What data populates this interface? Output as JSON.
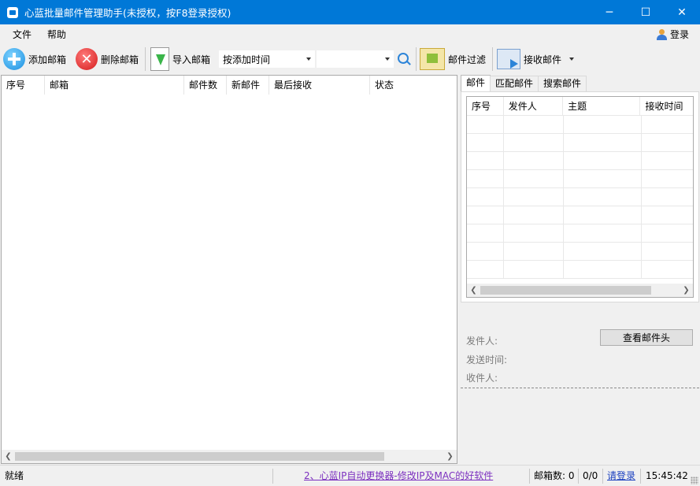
{
  "window": {
    "title": "心蓝批量邮件管理助手(未授权，按F8登录授权)"
  },
  "menu": {
    "items": [
      "文件",
      "帮助"
    ],
    "login": "登录"
  },
  "toolbar": {
    "add": "添加邮箱",
    "delete": "删除邮箱",
    "import": "导入邮箱",
    "sort_value": "按添加时间",
    "filter_value": "",
    "mail_filter": "邮件过滤",
    "receive": "接收邮件"
  },
  "mailbox_table": {
    "columns": [
      "序号",
      "邮箱",
      "邮件数",
      "新邮件",
      "最后接收",
      "状态"
    ]
  },
  "tabs": [
    "邮件",
    "匹配邮件",
    "搜索邮件"
  ],
  "mail_table": {
    "columns": [
      "序号",
      "发件人",
      "主题",
      "接收时间"
    ]
  },
  "detail": {
    "from": "发件人:",
    "sent_time": "发送时间:",
    "to": "收件人:",
    "view_header": "查看邮件头"
  },
  "status": {
    "ready": "就绪",
    "ad_link": "2、心蓝IP自动更换器-修改IP及MAC的好软件",
    "mailbox_count": "邮箱数: 0",
    "progress": "0/0",
    "login_link": "请登录",
    "time": "15:45:42"
  },
  "colors": {
    "titlebar": "#0078d7",
    "link_purple": "#7b2fbf",
    "link_blue": "#1a3fbf"
  }
}
